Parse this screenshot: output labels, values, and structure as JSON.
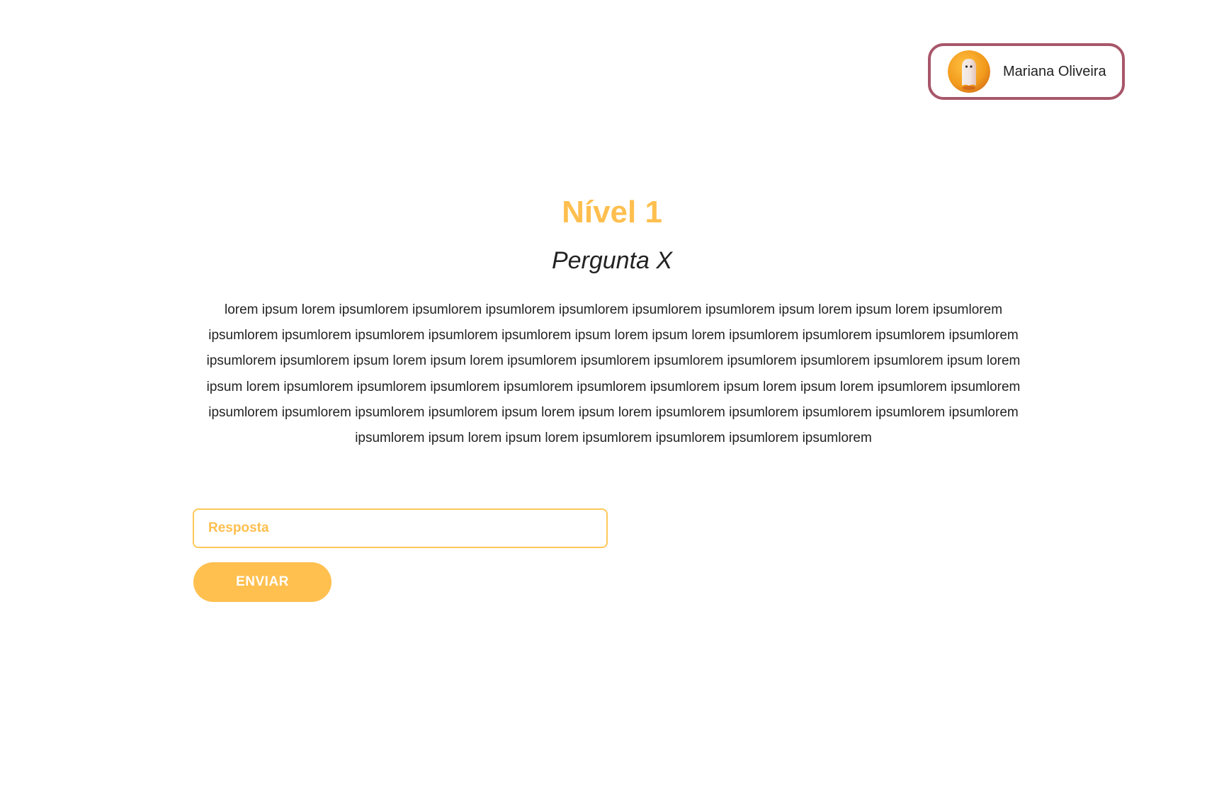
{
  "user": {
    "name": "Mariana Oliveira"
  },
  "question": {
    "level": "Nível 1",
    "title": "Pergunta X",
    "body": "lorem ipsum lorem ipsumlorem ipsumlorem ipsumlorem ipsumlorem ipsumlorem ipsumlorem ipsum lorem ipsum lorem ipsumlorem ipsumlorem ipsumlorem ipsumlorem ipsumlorem ipsumlorem ipsum lorem ipsum lorem ipsumlorem ipsumlorem ipsumlorem ipsumlorem ipsumlorem ipsumlorem ipsum lorem ipsum lorem ipsumlorem ipsumlorem ipsumlorem ipsumlorem ipsumlorem ipsumlorem ipsum lorem ipsum lorem ipsumlorem ipsumlorem ipsumlorem ipsumlorem ipsumlorem ipsumlorem ipsum lorem ipsum lorem ipsumlorem ipsumlorem ipsumlorem ipsumlorem ipsumlorem ipsumlorem ipsum lorem ipsum lorem ipsumlorem ipsumlorem ipsumlorem ipsumlorem ipsumlorem ipsumlorem ipsum lorem ipsum lorem ipsumlorem ipsumlorem ipsumlorem ipsumlorem"
  },
  "answer": {
    "placeholder": "Resposta",
    "value": ""
  },
  "submit": {
    "label": "ENVIAR"
  },
  "colors": {
    "accent": "#ffbf4f",
    "profile_border": "#a8566a",
    "text": "#222222"
  },
  "icons": {
    "avatar": "ghost-avatar-icon"
  }
}
